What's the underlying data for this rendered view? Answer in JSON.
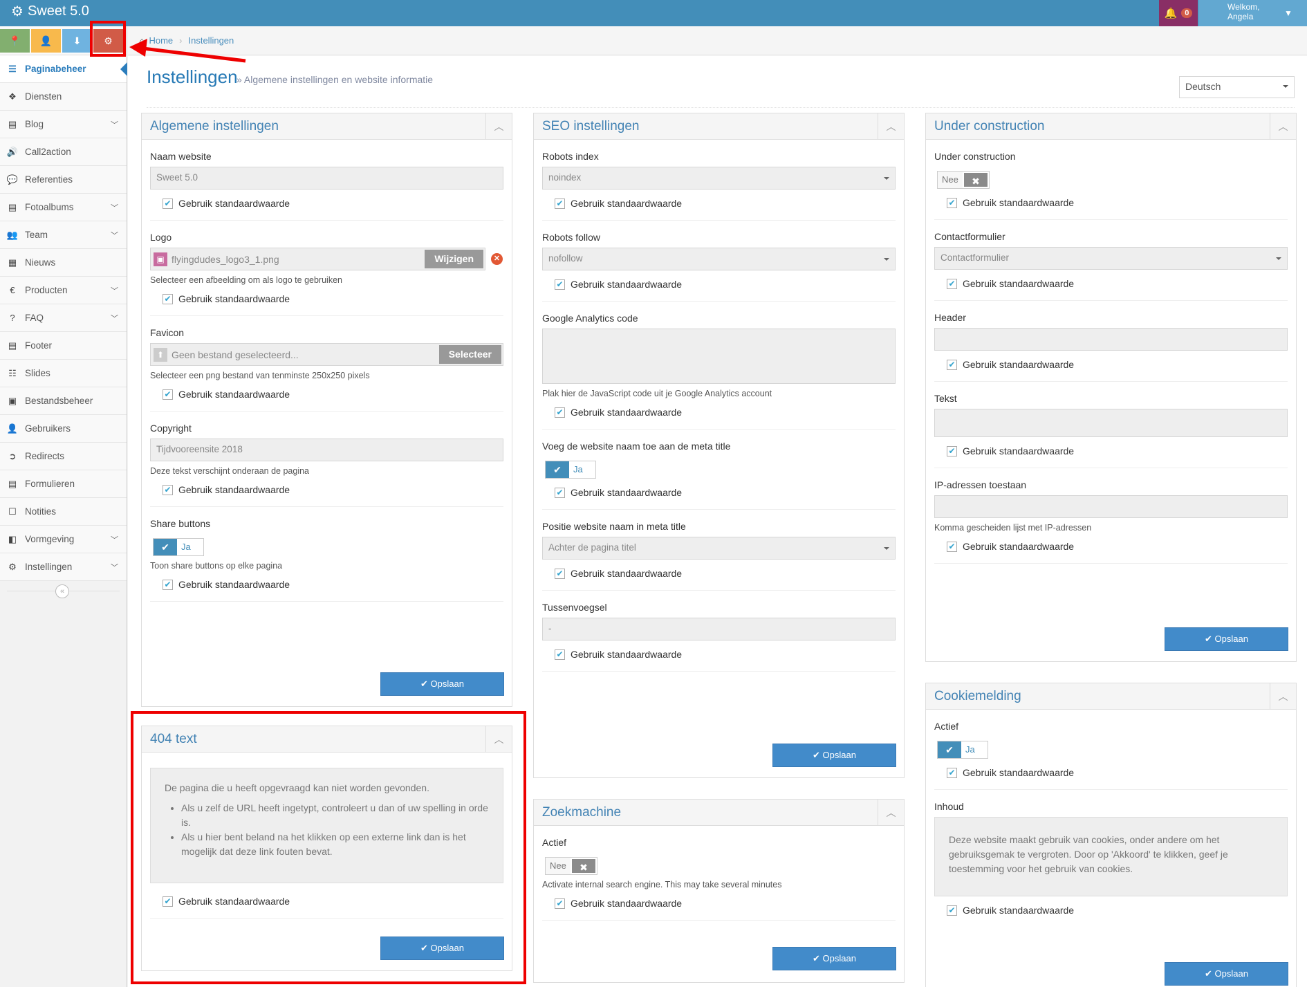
{
  "app": {
    "title": "Sweet 5.0"
  },
  "navbar": {
    "notify_count": "0",
    "welcome": "Welkom,",
    "user": "Angela"
  },
  "sidebar": {
    "items": [
      {
        "label": "Paginabeheer",
        "icon": "list-icon"
      },
      {
        "label": "Diensten",
        "icon": "cubes-icon"
      },
      {
        "label": "Blog",
        "icon": "book-icon"
      },
      {
        "label": "Call2action",
        "icon": "volume-icon"
      },
      {
        "label": "Referenties",
        "icon": "comment-icon"
      },
      {
        "label": "Fotoalbums",
        "icon": "book-icon"
      },
      {
        "label": "Team",
        "icon": "users-icon"
      },
      {
        "label": "Nieuws",
        "icon": "newspaper-icon"
      },
      {
        "label": "Producten",
        "icon": "euro-icon"
      },
      {
        "label": "FAQ",
        "icon": "question-icon"
      },
      {
        "label": "Footer",
        "icon": "list-alt-icon"
      },
      {
        "label": "Slides",
        "icon": "sliders-icon"
      },
      {
        "label": "Bestandsbeheer",
        "icon": "picture-icon"
      },
      {
        "label": "Gebruikers",
        "icon": "user-icon"
      },
      {
        "label": "Redirects",
        "icon": "arrow-circle-icon"
      },
      {
        "label": "Formulieren",
        "icon": "list-alt-icon"
      },
      {
        "label": "Notities",
        "icon": "note-icon"
      },
      {
        "label": "Vormgeving",
        "icon": "layout-icon"
      },
      {
        "label": "Instellingen",
        "icon": "gear-icon"
      }
    ]
  },
  "breadcrumb": {
    "home": "Home",
    "current": "Instellingen"
  },
  "page": {
    "title": "Instellingen",
    "subtitle": "» Algemene instellingen en website informatie",
    "language": "Deutsch"
  },
  "general": {
    "title": "Algemene instellingen",
    "naam_label": "Naam website",
    "naam_value": "Sweet 5.0",
    "logo_label": "Logo",
    "logo_file": "flyingdudes_logo3_1.png",
    "logo_btn": "Wijzigen",
    "logo_help": "Selecteer een afbeelding om als logo te gebruiken",
    "favicon_label": "Favicon",
    "favicon_file": "Geen bestand geselecteerd...",
    "favicon_btn": "Selecteer",
    "favicon_help": "Selecteer een png bestand van tenminste 250x250 pixels",
    "copyright_label": "Copyright",
    "copyright_value": "Tijdvooreensite 2018",
    "copyright_help": "Deze tekst verschijnt onderaan de pagina",
    "share_label": "Share buttons",
    "share_toggle": "Ja",
    "share_help": "Toon share buttons op elke pagina",
    "default": "Gebruik standaardwaarde",
    "save": "✔ Opslaan"
  },
  "notfound": {
    "title": "404 text",
    "intro": "De pagina die u heeft opgevraagd kan niet worden gevonden.",
    "bullet1": "Als u zelf de URL heeft ingetypt, controleert u dan of uw spelling in orde is.",
    "bullet2": "Als u hier bent beland na het klikken op een externe link dan is het mogelijk dat deze link fouten bevat.",
    "default": "Gebruik standaardwaarde",
    "save": "✔ Opslaan"
  },
  "seo": {
    "title": "SEO instellingen",
    "robots_index_label": "Robots index",
    "robots_index_value": "noindex",
    "robots_follow_label": "Robots follow",
    "robots_follow_value": "nofollow",
    "ga_label": "Google Analytics code",
    "ga_help": "Plak hier de JavaScript code uit je Google Analytics account",
    "meta_label": "Voeg de website naam toe aan de meta title",
    "meta_toggle": "Ja",
    "pos_label": "Positie website naam in meta title",
    "pos_value": "Achter de pagina titel",
    "tussen_label": "Tussenvoegsel",
    "tussen_value": "-",
    "default": "Gebruik standaardwaarde",
    "save": "✔ Opslaan"
  },
  "search": {
    "title": "Zoekmachine",
    "actief_label": "Actief",
    "actief_toggle": "Nee",
    "help": "Activate internal search engine. This may take several minutes",
    "default": "Gebruik standaardwaarde",
    "save": "✔ Opslaan"
  },
  "construction": {
    "title": "Under construction",
    "uc_label": "Under construction",
    "uc_toggle": "Nee",
    "contact_label": "Contactformulier",
    "contact_value": "Contactformulier",
    "header_label": "Header",
    "tekst_label": "Tekst",
    "ip_label": "IP-adressen toestaan",
    "ip_help": "Komma gescheiden lijst met IP-adressen",
    "default": "Gebruik standaardwaarde",
    "save": "✔ Opslaan"
  },
  "cookie": {
    "title": "Cookiemelding",
    "actief_label": "Actief",
    "actief_toggle": "Ja",
    "inhoud_label": "Inhoud",
    "inhoud_text": "Deze website maakt gebruik van cookies, onder andere om het gebruiksgemak te vergroten. Door op 'Akkoord' te klikken, geef je toestemming voor het gebruik van cookies.",
    "default": "Gebruik standaardwaarde",
    "save": "✔ Opslaan"
  },
  "colors": {
    "primary": "#438eb9",
    "accent_red": "#e00000",
    "save": "#428bca"
  }
}
